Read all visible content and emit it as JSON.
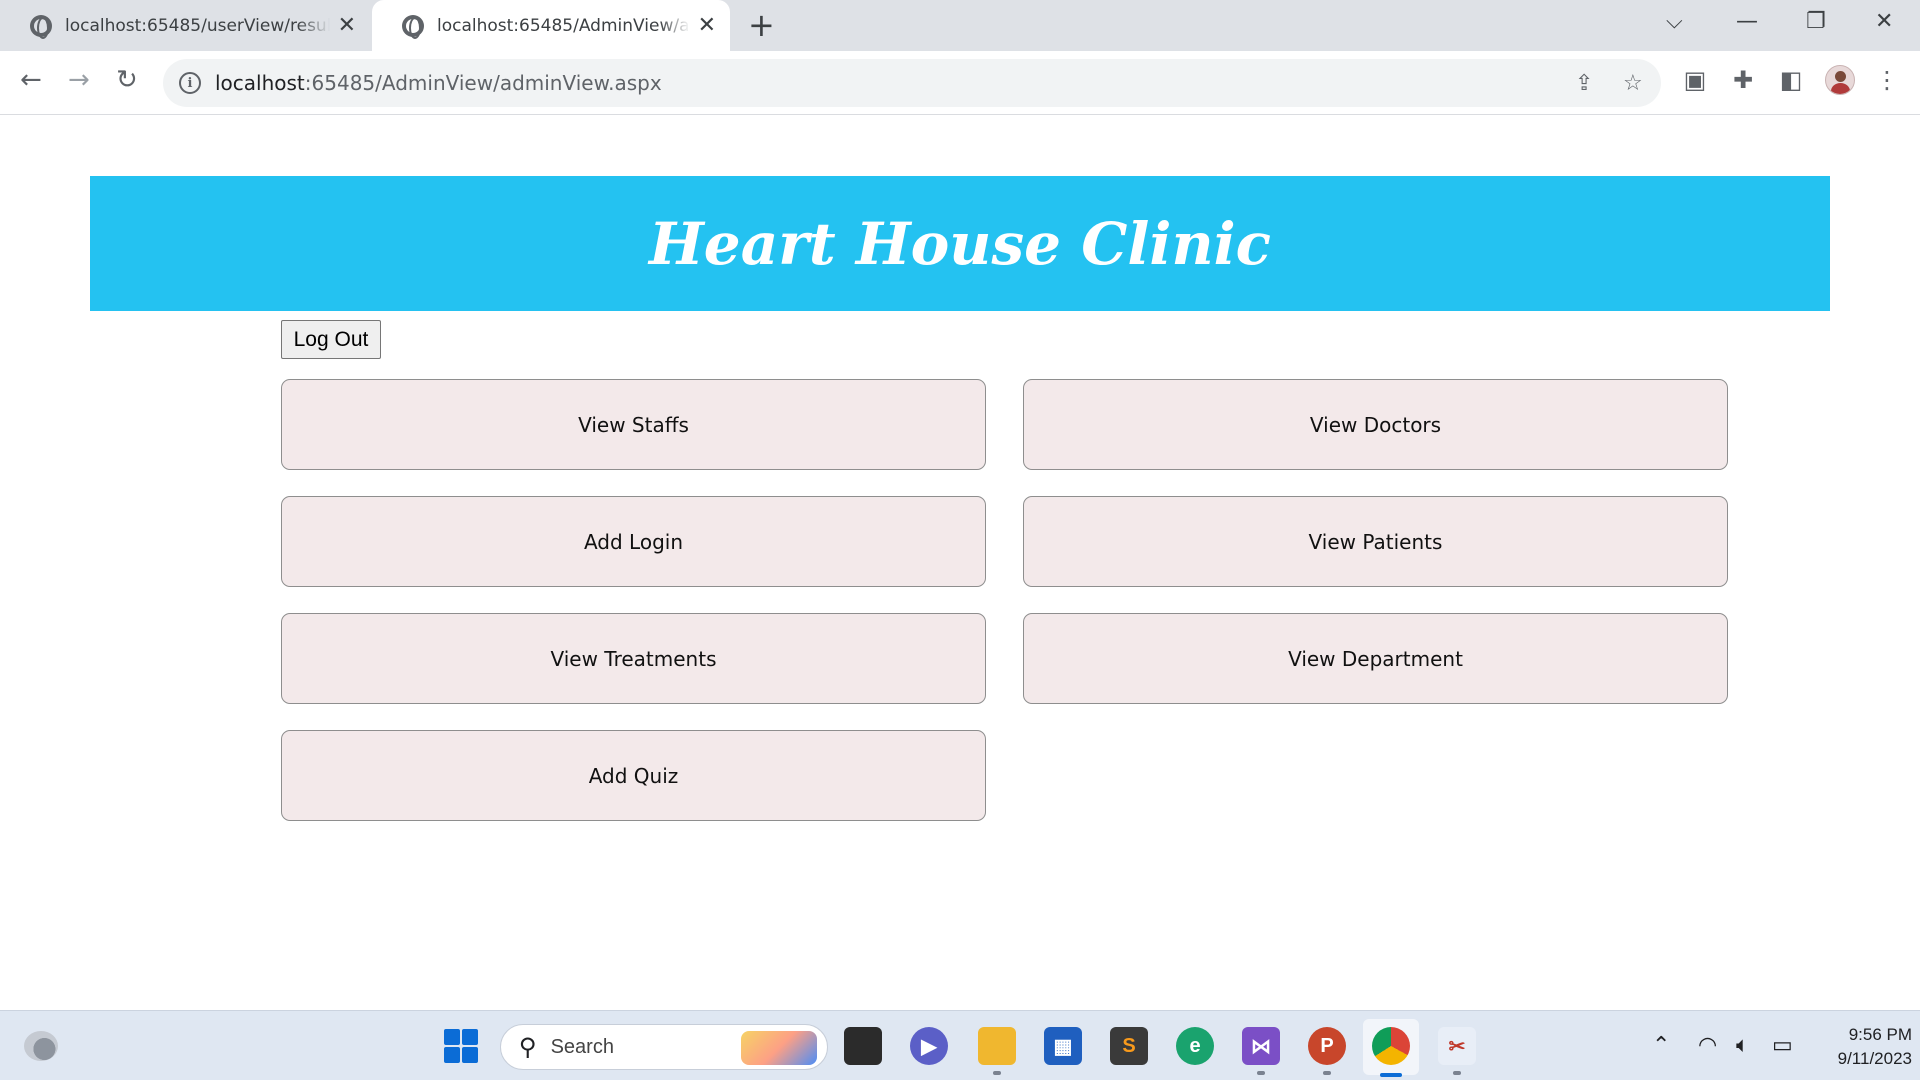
{
  "browser": {
    "tabs": [
      {
        "title": "localhost:65485/userView/result.aspx",
        "active": false
      },
      {
        "title": "localhost:65485/AdminView/adminView.aspx",
        "active": true
      }
    ],
    "new_tab_icon": "plus-icon",
    "address": {
      "host": "localhost",
      "path": ":65485/AdminView/adminView.aspx"
    }
  },
  "page": {
    "banner_title": "Heart House Clinic",
    "banner_color": "#24c2f1",
    "logout_label": "Log Out",
    "menu": [
      {
        "label": "View Staffs"
      },
      {
        "label": "View Doctors"
      },
      {
        "label": "Add Login"
      },
      {
        "label": "View Patients"
      },
      {
        "label": "View Treatments"
      },
      {
        "label": "View Department"
      },
      {
        "label": "Add Quiz"
      }
    ],
    "button_bg": "#f3e9ea"
  },
  "taskbar": {
    "search_label": "Search",
    "time": "9:56 PM",
    "date": "9/11/2023"
  }
}
